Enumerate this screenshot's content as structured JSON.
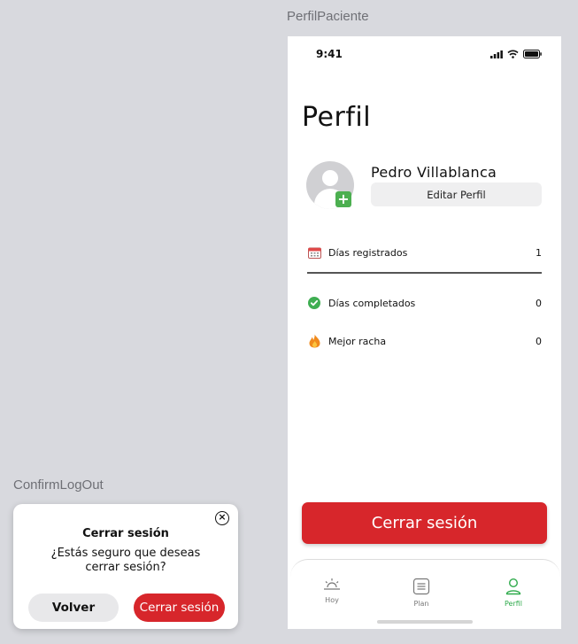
{
  "frames": {
    "perfil_label": "PerfilPaciente",
    "logout_label": "ConfirmLogOut"
  },
  "status_bar": {
    "time": "9:41"
  },
  "profile": {
    "title": "Perfil",
    "user_name": "Pedro Villablanca",
    "edit_label": "Editar Perfil",
    "stats": [
      {
        "icon": "calendar-icon",
        "label": "Días registrados",
        "value": "1"
      },
      {
        "icon": "check-circle-icon",
        "label": "Días completados",
        "value": "0"
      },
      {
        "icon": "flame-icon",
        "label": "Mejor racha",
        "value": "0"
      }
    ],
    "logout_label": "Cerrar sesión"
  },
  "tabbar": {
    "tabs": [
      {
        "icon": "sunrise-icon",
        "label": "Hoy",
        "active": false
      },
      {
        "icon": "list-icon",
        "label": "Plan",
        "active": false
      },
      {
        "icon": "person-icon",
        "label": "Perfil",
        "active": true
      }
    ],
    "active_color": "#2eaa4b"
  },
  "dialog": {
    "title": "Cerrar sesión",
    "message": "¿Estás seguro que deseas cerrar sesión?",
    "back_label": "Volver",
    "confirm_label": "Cerrar sesión"
  },
  "colors": {
    "primary_red": "#d7262b",
    "success_green": "#4caf50"
  }
}
